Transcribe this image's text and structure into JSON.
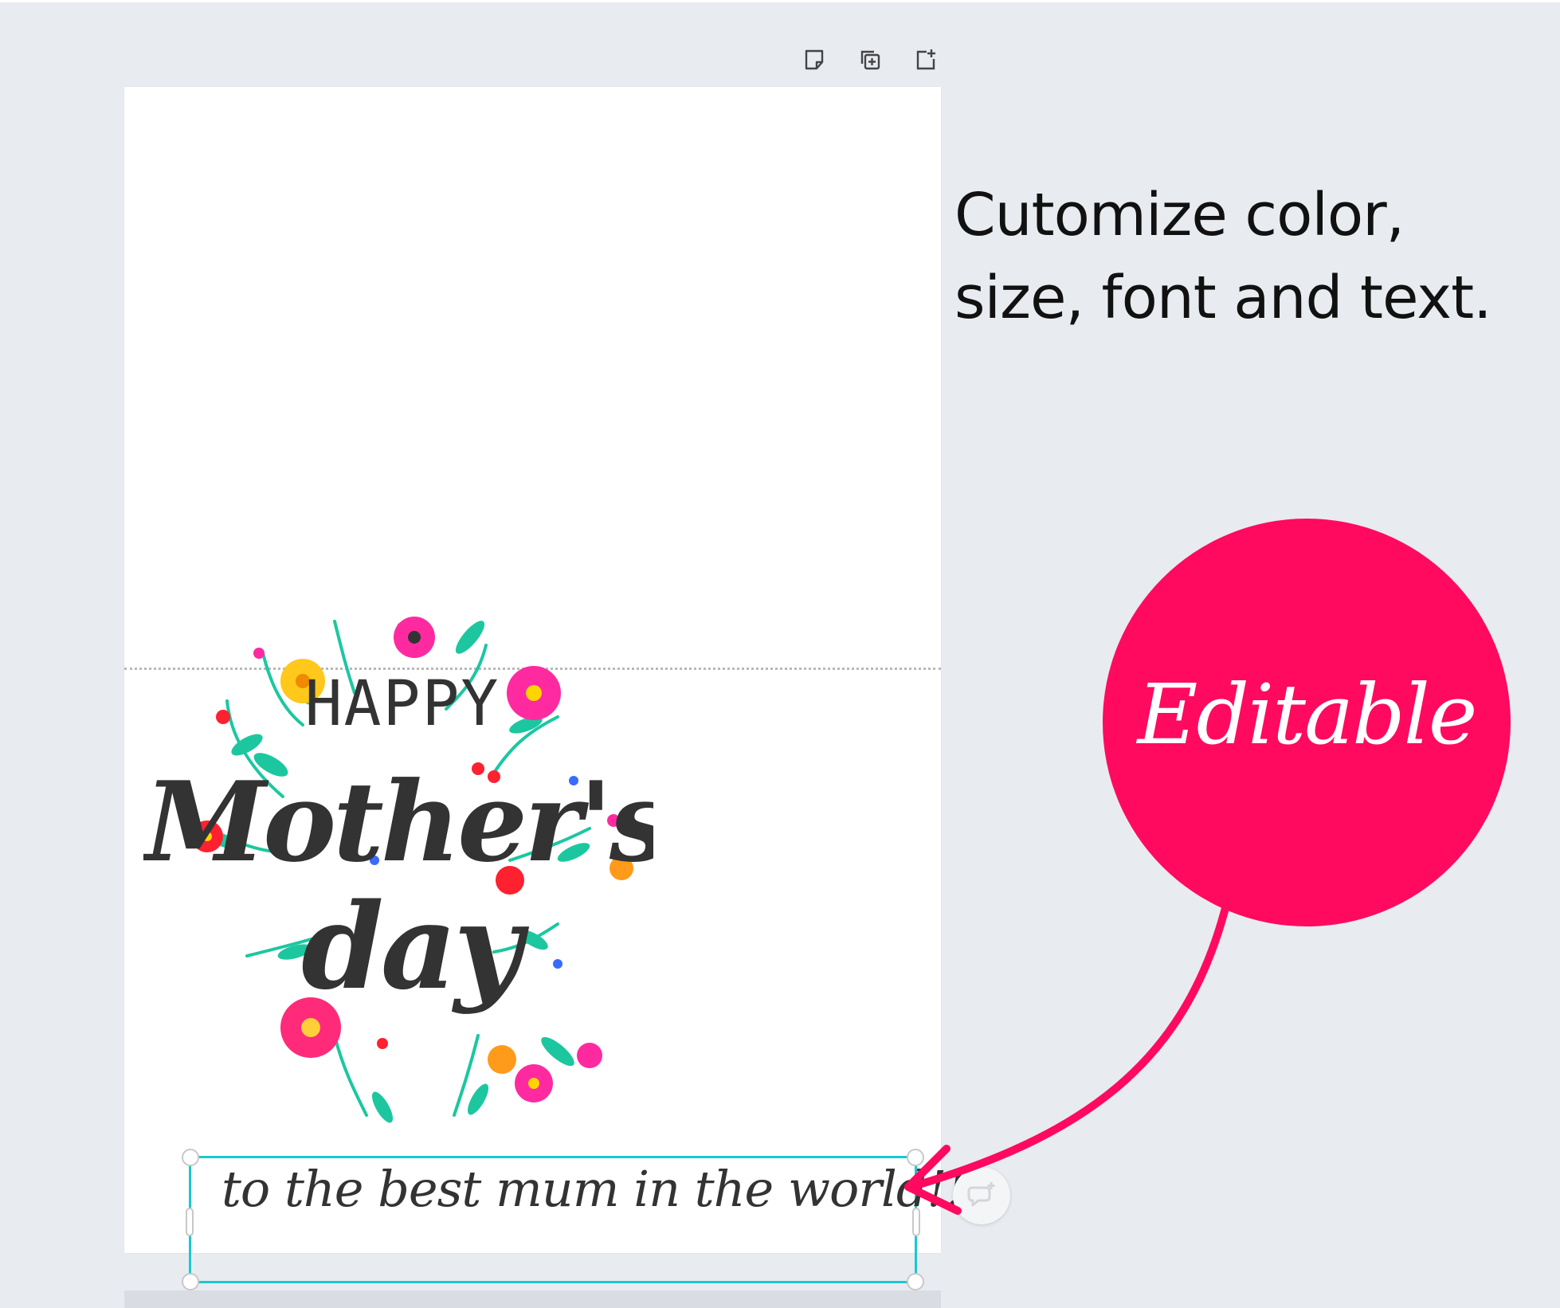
{
  "instructions": {
    "line1": "Cutomize color,",
    "line2": "size, font and text."
  },
  "badge": {
    "label": "Editable",
    "color": "#ff0a5f"
  },
  "card": {
    "artwork": {
      "line1": "HAPPY",
      "line2": "Mother's",
      "line3": "day"
    },
    "tagline": "to the best mum in the world!!!"
  },
  "toolbar": {
    "icons": [
      "add-note-icon",
      "duplicate-page-icon",
      "add-page-icon"
    ]
  },
  "colors": {
    "canvas": "#e8ebf0",
    "selection": "#19c9cf",
    "accent": "#ff0a5f"
  }
}
